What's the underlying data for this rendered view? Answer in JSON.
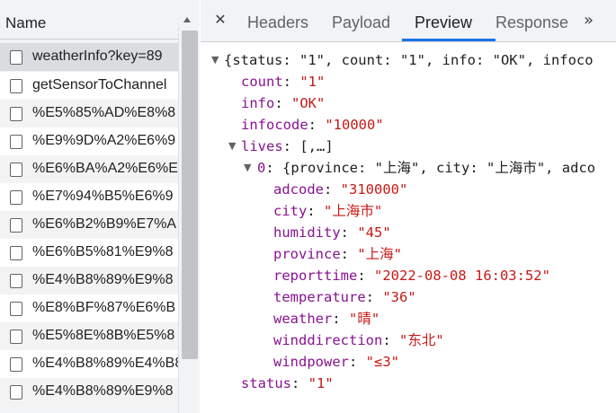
{
  "list": {
    "header_label": "Name",
    "requests": [
      "weatherInfo?key=89",
      "getSensorToChannel",
      "%E5%85%AD%E8%8",
      "%E9%9D%A2%E6%9",
      "%E6%BA%A2%E6%E",
      "%E7%94%B5%E6%9",
      "%E6%B2%B9%E7%A",
      "%E6%B5%81%E9%8",
      "%E4%B8%89%E9%8",
      "%E8%BF%87%E6%B",
      "%E5%8E%8B%E5%8",
      "%E4%B8%89%E4%B8",
      "%E4%B8%89%E9%8"
    ]
  },
  "tabs": {
    "close_symbol": "✕",
    "headers": "Headers",
    "payload": "Payload",
    "preview": "Preview",
    "response": "Response",
    "more_symbol": "»"
  },
  "preview": {
    "summary": "{status: \"1\", count: \"1\", info: \"OK\", infoco",
    "count_key": "count",
    "count_val": "\"1\"",
    "info_key": "info",
    "info_val": "\"OK\"",
    "infocode_key": "infocode",
    "infocode_val": "\"10000\"",
    "lives_key": "lives",
    "lives_val": "[,…]",
    "item_index": "0",
    "item_summary": "{province: \"上海\", city: \"上海市\", adco",
    "fields": [
      {
        "key": "adcode",
        "value": "\"310000\""
      },
      {
        "key": "city",
        "value": "\"上海市\""
      },
      {
        "key": "humidity",
        "value": "\"45\""
      },
      {
        "key": "province",
        "value": "\"上海\""
      },
      {
        "key": "reporttime",
        "value": "\"2022-08-08 16:03:52\""
      },
      {
        "key": "temperature",
        "value": "\"36\""
      },
      {
        "key": "weather",
        "value": "\"晴\""
      },
      {
        "key": "winddirection",
        "value": "\"东北\""
      },
      {
        "key": "windpower",
        "value": "\"≤3\""
      }
    ],
    "status_key": "status",
    "status_val": "\"1\""
  },
  "colors": {
    "key": "#881391",
    "string": "#c41a16",
    "active_tab_underline": "#1a73e8"
  }
}
